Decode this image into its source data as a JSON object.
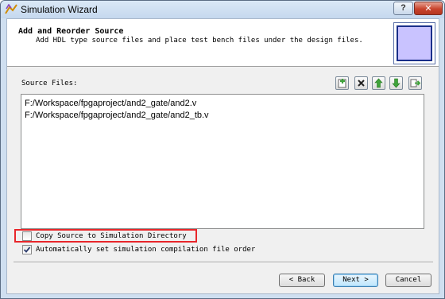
{
  "window": {
    "title": "Simulation Wizard",
    "help_label": "?",
    "close_label": "✕"
  },
  "header": {
    "title": "Add and Reorder Source",
    "subtitle": "Add HDL type source files and place test bench files under the design files."
  },
  "source": {
    "label": "Source Files:",
    "toolbar": [
      "add-icon",
      "remove-icon",
      "move-up-icon",
      "move-down-icon",
      "export-icon"
    ],
    "files": [
      "F:/Workspace/fpgaproject/and2_gate/and2.v",
      "F:/Workspace/fpgaproject/and2_gate/and2_tb.v"
    ]
  },
  "options": {
    "copy_source_label": "Copy Source to Simulation Directory",
    "copy_source_checked": false,
    "auto_order_label": "Automatically set simulation compilation file order",
    "auto_order_checked": true
  },
  "buttons": {
    "back": "< Back",
    "next": "Next >",
    "cancel": "Cancel"
  },
  "colors": {
    "highlight": "#e8262a",
    "header_image_fill": "#c9c3ff",
    "toolbar_green": "#3fa33a"
  }
}
